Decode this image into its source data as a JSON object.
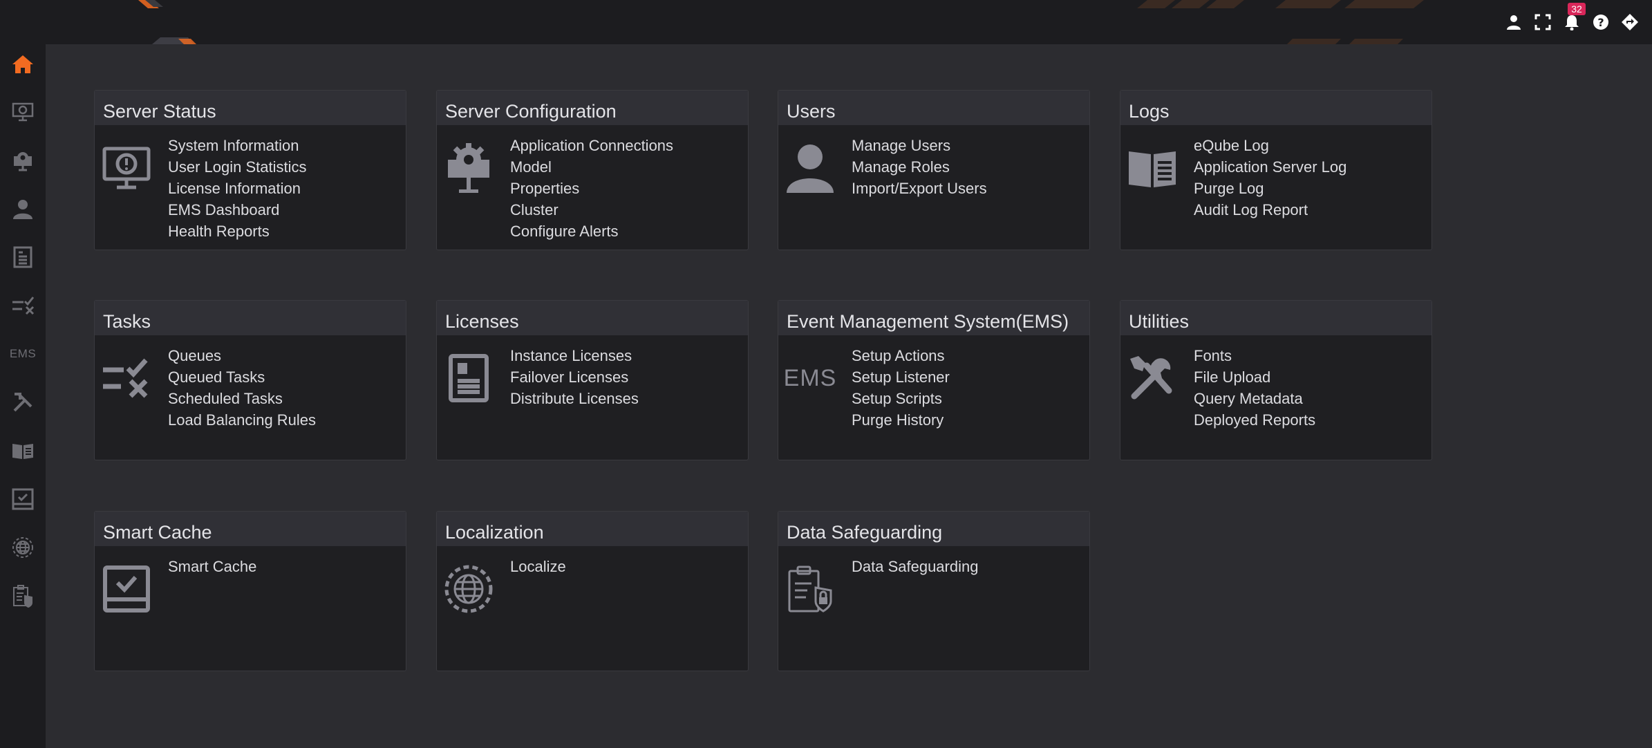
{
  "header": {
    "notification_count": "32",
    "icons": [
      "user-icon",
      "fullscreen-icon",
      "bell-icon",
      "help-icon",
      "navigate-icon"
    ]
  },
  "sidebar": {
    "items": [
      {
        "icon": "home-icon",
        "active": true
      },
      {
        "icon": "monitor-icon"
      },
      {
        "icon": "config-icon"
      },
      {
        "icon": "user-icon"
      },
      {
        "icon": "license-icon"
      },
      {
        "icon": "tasks-icon"
      },
      {
        "label": "EMS"
      },
      {
        "icon": "tools-icon"
      },
      {
        "icon": "book-icon"
      },
      {
        "icon": "tablet-check-icon"
      },
      {
        "icon": "globe-gear-icon"
      },
      {
        "icon": "clipboard-lock-icon"
      }
    ]
  },
  "colors": {
    "accent": "#f26b21",
    "icon_gray": "#8a8a93",
    "badge": "#d9275a"
  },
  "cards": {
    "server_status": {
      "title": "Server Status",
      "links": [
        "System Information",
        "User Login Statistics",
        "License Information",
        "EMS Dashboard",
        "Health Reports"
      ]
    },
    "server_configuration": {
      "title": "Server Configuration",
      "links": [
        "Application Connections",
        "Model",
        "Properties",
        "Cluster",
        "Configure Alerts"
      ]
    },
    "users": {
      "title": "Users",
      "links": [
        "Manage Users",
        "Manage Roles",
        "Import/Export Users"
      ]
    },
    "logs": {
      "title": "Logs",
      "links": [
        "eQube Log",
        "Application Server Log",
        "Purge Log",
        "Audit Log Report"
      ]
    },
    "tasks": {
      "title": "Tasks",
      "links": [
        "Queues",
        "Queued Tasks",
        "Scheduled Tasks",
        "Load Balancing Rules"
      ]
    },
    "licenses": {
      "title": "Licenses",
      "links": [
        "Instance Licenses",
        "Failover Licenses",
        "Distribute Licenses"
      ]
    },
    "ems": {
      "title": "Event Management System(EMS)",
      "icon_text": "EMS",
      "links": [
        "Setup Actions",
        "Setup Listener",
        "Setup Scripts",
        "Purge History"
      ]
    },
    "utilities": {
      "title": "Utilities",
      "links": [
        "Fonts",
        "File Upload",
        "Query Metadata",
        "Deployed Reports"
      ]
    },
    "smart_cache": {
      "title": "Smart Cache",
      "links": [
        "Smart Cache"
      ]
    },
    "localization": {
      "title": "Localization",
      "links": [
        "Localize"
      ]
    },
    "data_safeguarding": {
      "title": "Data Safeguarding",
      "links": [
        "Data Safeguarding"
      ]
    }
  }
}
